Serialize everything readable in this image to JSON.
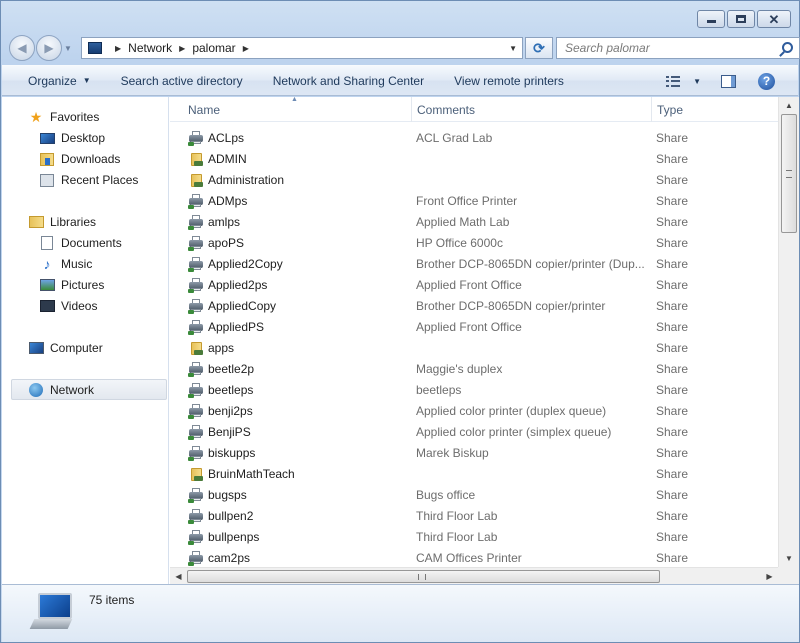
{
  "window": {
    "caption_buttons": [
      "minimize",
      "maximize",
      "close"
    ]
  },
  "address_bar": {
    "breadcrumbs": [
      "Network",
      "palomar"
    ]
  },
  "search": {
    "placeholder": "Search palomar"
  },
  "toolbar": {
    "organize": "Organize",
    "search_ad": "Search active directory",
    "network_sharing": "Network and Sharing Center",
    "remote_printers": "View remote printers"
  },
  "nav": {
    "favorites": "Favorites",
    "desktop": "Desktop",
    "downloads": "Downloads",
    "recent_places": "Recent Places",
    "libraries": "Libraries",
    "documents": "Documents",
    "music": "Music",
    "pictures": "Pictures",
    "videos": "Videos",
    "computer": "Computer",
    "network": "Network"
  },
  "columns": {
    "name": "Name",
    "comments": "Comments",
    "type": "Type"
  },
  "files": [
    {
      "name": "ACLps",
      "comment": "ACL Grad Lab",
      "type": "Share",
      "icon": "printer"
    },
    {
      "name": "ADMIN",
      "comment": "",
      "type": "Share",
      "icon": "folder"
    },
    {
      "name": "Administration",
      "comment": "",
      "type": "Share",
      "icon": "folder"
    },
    {
      "name": "ADMps",
      "comment": "Front Office Printer",
      "type": "Share",
      "icon": "printer"
    },
    {
      "name": "amlps",
      "comment": "Applied Math Lab",
      "type": "Share",
      "icon": "printer"
    },
    {
      "name": "apoPS",
      "comment": "HP Office 6000c",
      "type": "Share",
      "icon": "printer"
    },
    {
      "name": "Applied2Copy",
      "comment": "Brother DCP-8065DN copier/printer (Dup...",
      "type": "Share",
      "icon": "printer"
    },
    {
      "name": "Applied2ps",
      "comment": "Applied Front Office",
      "type": "Share",
      "icon": "printer"
    },
    {
      "name": "AppliedCopy",
      "comment": "Brother DCP-8065DN copier/printer",
      "type": "Share",
      "icon": "printer"
    },
    {
      "name": "AppliedPS",
      "comment": "Applied Front Office",
      "type": "Share",
      "icon": "printer"
    },
    {
      "name": "apps",
      "comment": "",
      "type": "Share",
      "icon": "folder"
    },
    {
      "name": "beetle2p",
      "comment": "Maggie's duplex",
      "type": "Share",
      "icon": "printer"
    },
    {
      "name": "beetleps",
      "comment": "beetleps",
      "type": "Share",
      "icon": "printer"
    },
    {
      "name": "benji2ps",
      "comment": "Applied color printer (duplex queue)",
      "type": "Share",
      "icon": "printer"
    },
    {
      "name": "BenjiPS",
      "comment": "Applied color printer (simplex queue)",
      "type": "Share",
      "icon": "printer"
    },
    {
      "name": "biskupps",
      "comment": "Marek Biskup",
      "type": "Share",
      "icon": "printer"
    },
    {
      "name": "BruinMathTeach",
      "comment": "",
      "type": "Share",
      "icon": "folder"
    },
    {
      "name": "bugsps",
      "comment": "Bugs office",
      "type": "Share",
      "icon": "printer"
    },
    {
      "name": "bullpen2",
      "comment": "Third Floor Lab",
      "type": "Share",
      "icon": "printer"
    },
    {
      "name": "bullpenps",
      "comment": "Third Floor Lab",
      "type": "Share",
      "icon": "printer"
    },
    {
      "name": "cam2ps",
      "comment": "CAM Offices Printer",
      "type": "Share",
      "icon": "printer"
    }
  ],
  "status": {
    "item_count": "75 items"
  }
}
